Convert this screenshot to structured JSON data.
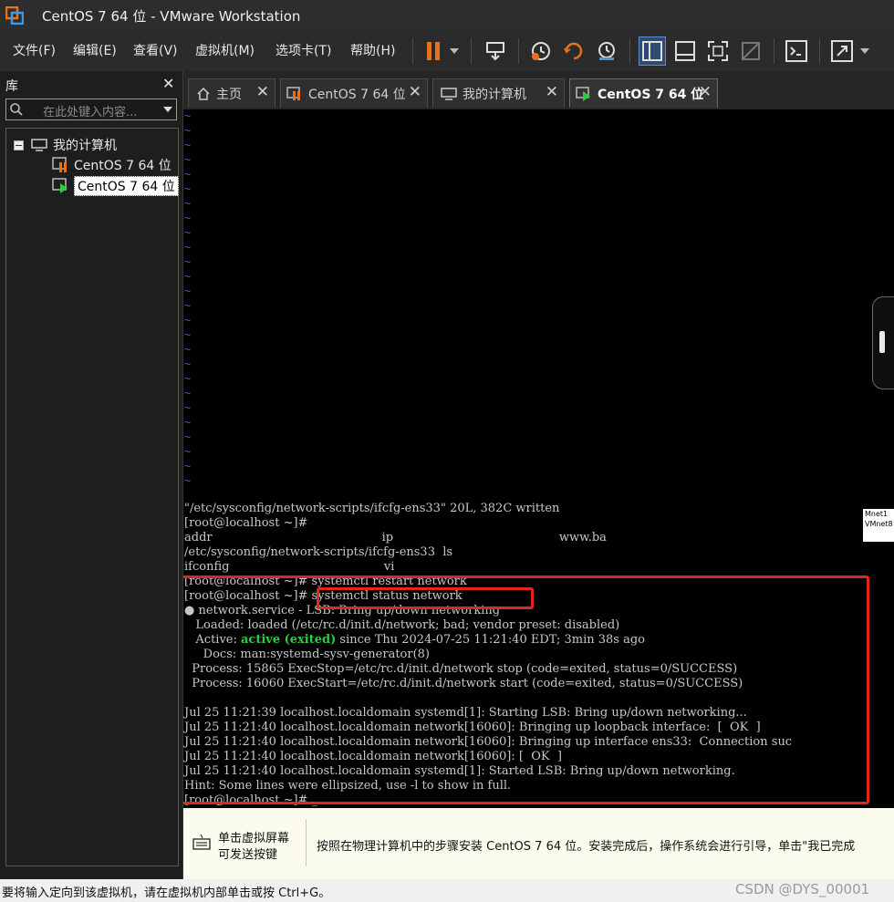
{
  "window": {
    "title": "CentOS 7 64 位 - VMware Workstation"
  },
  "menu": [
    {
      "label": "文件(F)"
    },
    {
      "label": "编辑(E)"
    },
    {
      "label": "查看(V)"
    },
    {
      "label": "虚拟机(M)"
    },
    {
      "label": "选项卡(T)"
    },
    {
      "label": "帮助(H)"
    }
  ],
  "library": {
    "title": "库",
    "close": "✕",
    "search_placeholder": "在此处键入内容...",
    "tree": {
      "root": "我的计算机",
      "items": [
        "CentOS 7 64 位",
        "CentOS 7 64 位"
      ]
    }
  },
  "tabs": [
    {
      "label": "主页",
      "close": "✕"
    },
    {
      "label": "CentOS 7 64 位",
      "close": "✕"
    },
    {
      "label": "我的计算机",
      "close": "✕"
    },
    {
      "label": "CentOS 7 64 位",
      "close": "✕"
    }
  ],
  "terminal": {
    "tilde": "~",
    "lines": [
      "\"/etc/sysconfig/network-scripts/ifcfg-ens33\" 20L, 382C written",
      "[root@localhost ~]#",
      "addr                                             ip                                            www.ba",
      "/etc/sysconfig/network-scripts/ifcfg-ens33  ls",
      "ifconfig                                         vi",
      "[root@localhost ~]# systemctl restart network",
      "[root@localhost ~]# systemctl status network",
      "● network.service - LSB: Bring up/down networking",
      "   Loaded: loaded (/etc/rc.d/init.d/network; bad; vendor preset: disabled)",
      "   Active: ",
      "     Docs: man:systemd-sysv-generator(8)",
      "  Process: 15865 ExecStop=/etc/rc.d/init.d/network stop (code=exited, status=0/SUCCESS)",
      "  Process: 16060 ExecStart=/etc/rc.d/init.d/network start (code=exited, status=0/SUCCESS)",
      "",
      "Jul 25 11:21:39 localhost.localdomain systemd[1]: Starting LSB: Bring up/down networking...",
      "Jul 25 11:21:40 localhost.localdomain network[16060]: Bringing up loopback interface:  [  OK  ]",
      "Jul 25 11:21:40 localhost.localdomain network[16060]: Bringing up interface ens33:  Connection suc",
      "Jul 25 11:21:40 localhost.localdomain network[16060]: [  OK  ]",
      "Jul 25 11:21:40 localhost.localdomain systemd[1]: Started LSB: Bring up/down networking.",
      "Hint: Some lines were ellipsized, use -l to show in full.",
      "[root@localhost ~]# _"
    ],
    "active_status": "active (exited)",
    "active_rest": " since Thu 2024-07-25 11:21:40 EDT; 3min 38s ago"
  },
  "vmnet_tip": {
    "line1": "Mnet1",
    "line2": "VMnet8"
  },
  "infobar": {
    "left_line1": "单击虚拟屏幕",
    "left_line2": "可发送按键",
    "message": "按照在物理计算机中的步骤安装 CentOS 7 64 位。安装完成后，操作系统会进行引导，单击\"我已完成"
  },
  "statusbar": {
    "text": "要将输入定向到该虚拟机，请在虚拟机内部单击或按 Ctrl+G。",
    "watermark": "CSDN @DYS_00001"
  },
  "colors": {
    "accent_orange": "#e8711c",
    "highlight_red": "#e3261d",
    "active_green": "#2ecc40"
  }
}
